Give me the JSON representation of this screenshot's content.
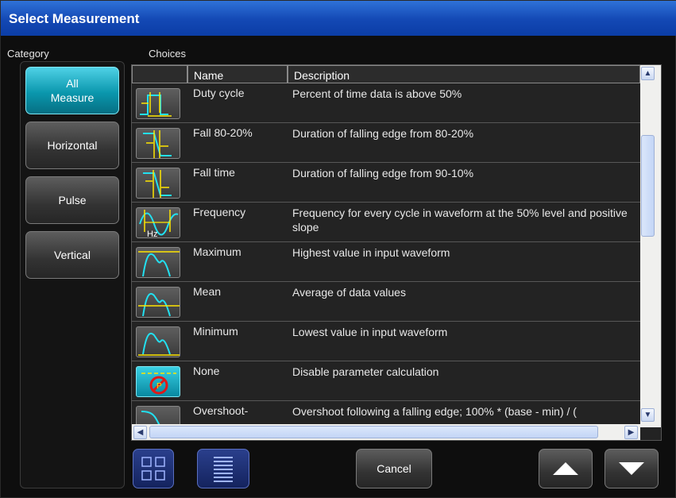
{
  "window": {
    "title": "Select Measurement"
  },
  "labels": {
    "category": "Category",
    "choices": "Choices"
  },
  "categories": [
    {
      "label": "All\nMeasure",
      "active": true
    },
    {
      "label": "Horizontal",
      "active": false
    },
    {
      "label": "Pulse",
      "active": false
    },
    {
      "label": "Vertical",
      "active": false
    }
  ],
  "table": {
    "columns": [
      "Name",
      "Description"
    ],
    "rows": [
      {
        "name": "Duty cycle",
        "description": "Percent of time data is above 50%",
        "icon": "duty-cycle-icon"
      },
      {
        "name": "Fall 80-20%",
        "description": "Duration of falling edge from 80-20%",
        "icon": "fall-80-20-icon"
      },
      {
        "name": "Fall time",
        "description": "Duration of falling edge from 90-10%",
        "icon": "fall-time-icon"
      },
      {
        "name": "Frequency",
        "description": "Frequency for every cycle in waveform at the 50% level and positive slope",
        "icon": "frequency-icon",
        "icon_text": "Hz"
      },
      {
        "name": "Maximum",
        "description": "Highest value in input waveform",
        "icon": "maximum-icon"
      },
      {
        "name": "Mean",
        "description": "Average of data values",
        "icon": "mean-icon"
      },
      {
        "name": "Minimum",
        "description": "Lowest value in input waveform",
        "icon": "minimum-icon"
      },
      {
        "name": "None",
        "description": "Disable parameter calculation",
        "icon": "none-icon",
        "selected": true
      },
      {
        "name": "Overshoot-",
        "description": "Overshoot following a falling edge; 100% * (base - min) / (",
        "icon": "overshoot-minus-icon"
      }
    ]
  },
  "footer": {
    "cancel_label": "Cancel"
  },
  "colors": {
    "title_bar": "#1a55c4",
    "accent_cyan": "#0fb3c8",
    "trace_cyan": "#22e0f0",
    "marker_yellow": "#ffe600",
    "none_red": "#e01818"
  }
}
